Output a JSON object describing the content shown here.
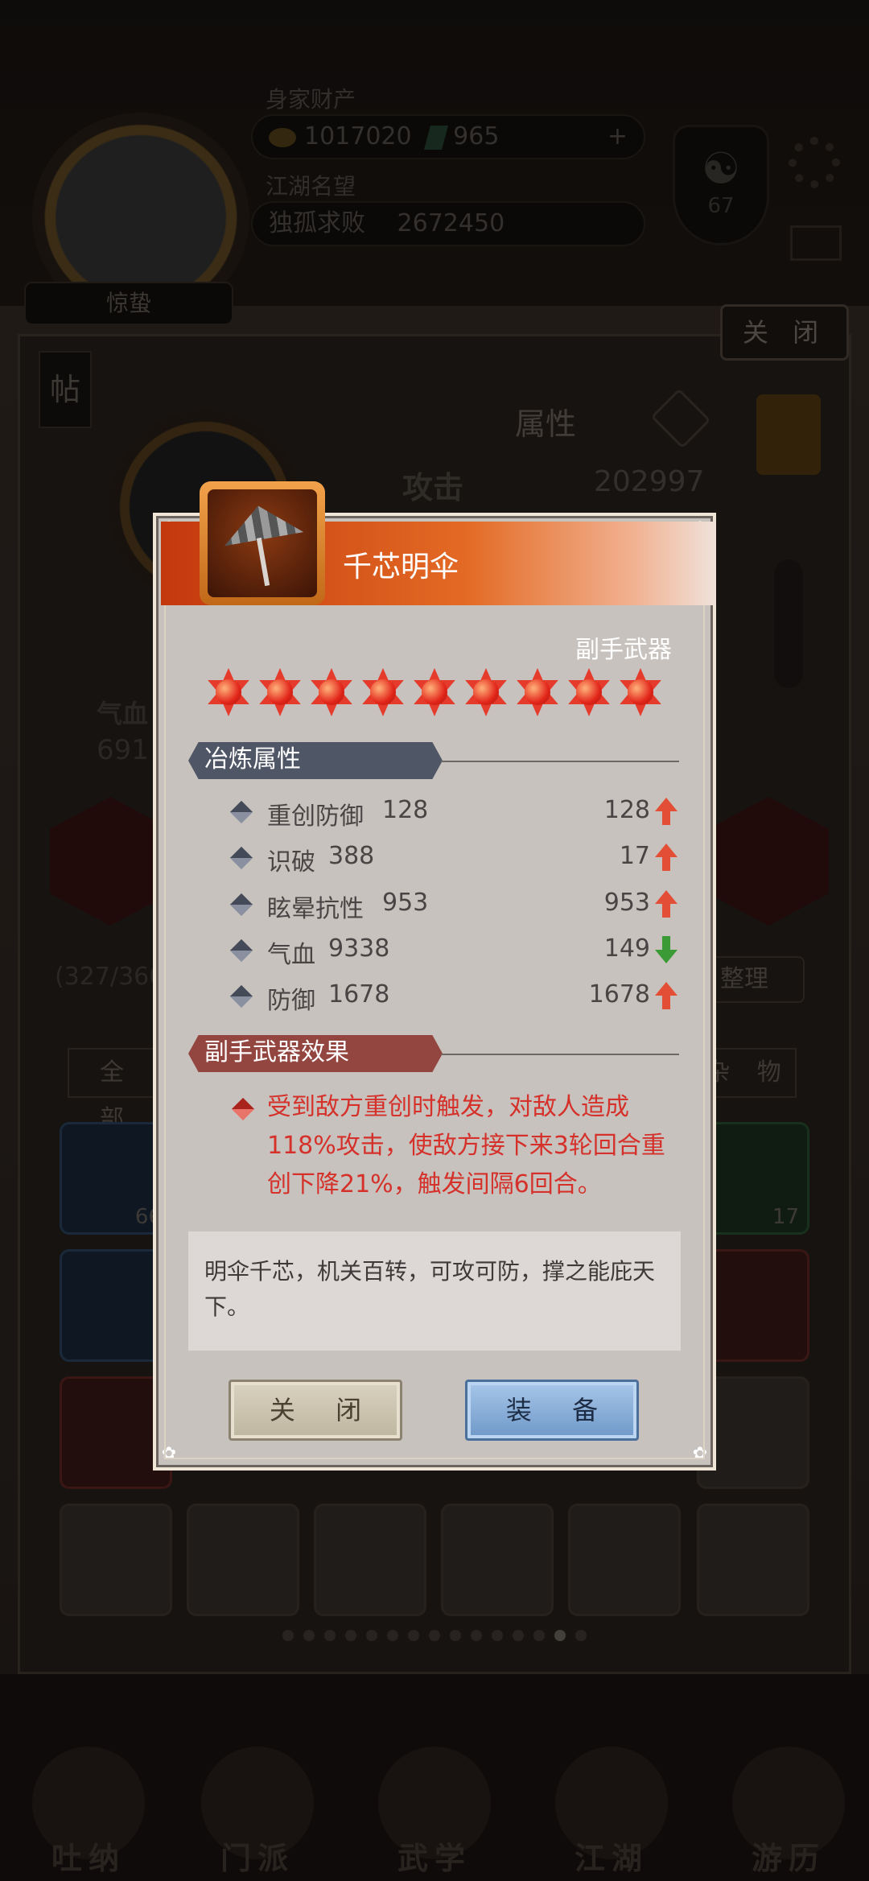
{
  "background": {
    "wealth_label": "身家财产",
    "coins": "1017020",
    "jade": "965",
    "plus": "+",
    "fame_label": "江湖名望",
    "fame_title": "独孤求败",
    "fame_value": "2672450",
    "yinyang_level": "67",
    "player_badge": "惊蛰",
    "close_top": "关 闭",
    "tie_label": "帖",
    "attr_title": "属性",
    "attack_label": "攻击",
    "attack_value": "202997",
    "hp_label": "气血",
    "hp_value_partial": "691",
    "bag_count_partial": "(327/360",
    "sort_button_partial": "整理",
    "tab_all": "全 部",
    "tab_misc": "杂 物",
    "slot_counts": [
      "66",
      "17"
    ],
    "nav": [
      "吐纳",
      "门派",
      "武学",
      "江湖",
      "游历"
    ]
  },
  "item": {
    "name": "千芯明伞",
    "type": "副手武器",
    "stars": 9,
    "colors": {
      "title_bar": "#e3561c",
      "star": "#e53b2c",
      "effect_text": "#d5312a"
    }
  },
  "refine_section": {
    "title": "冶炼属性"
  },
  "stats": [
    {
      "name": "重创防御",
      "value": "128",
      "delta": "128",
      "trend": "up"
    },
    {
      "name": "识破",
      "value": "388",
      "delta": "17",
      "trend": "up"
    },
    {
      "name": "眩晕抗性",
      "value": "953",
      "delta": "953",
      "trend": "up"
    },
    {
      "name": "气血",
      "value": "9338",
      "delta": "149",
      "trend": "down"
    },
    {
      "name": "防御",
      "value": "1678",
      "delta": "1678",
      "trend": "up"
    }
  ],
  "effect_section": {
    "title": "副手武器效果",
    "text": "受到敌方重创时触发，对敌人造成118%攻击，使敌方接下来3轮回合重创下降21%，触发间隔6回合。"
  },
  "description": "明伞千芯，机关百转，可攻可防，撑之能庇天下。",
  "buttons": {
    "close": "关 闭",
    "equip": "装 备"
  }
}
